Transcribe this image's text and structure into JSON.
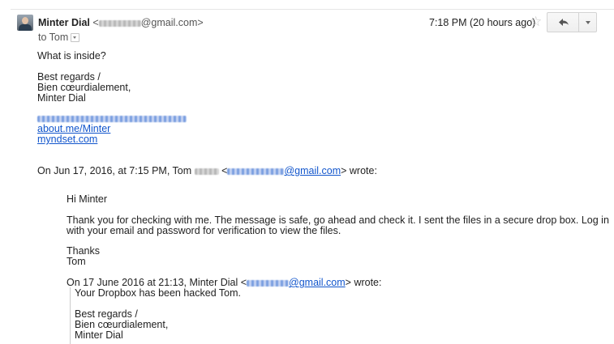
{
  "header": {
    "sender_name": "Minter Dial",
    "sender_email_pre": "<",
    "sender_email_domain": "@gmail.com>",
    "recipient_line": "to Tom",
    "date": "7:18 PM (20 hours ago)"
  },
  "body": {
    "line1": "What is inside?",
    "sig1": "Best regards /",
    "sig2": "Bien cœurdialement,",
    "sig3": "Minter Dial",
    "link1": "about.me/Minter",
    "link2": "myndset.com",
    "quote_head_pre": "On Jun 17, 2016, at 7:15 PM, Tom",
    "quote_head_mid": "<",
    "quote_head_domain": "@gmail.com",
    "quote_head_post": "> wrote:"
  },
  "quote": {
    "greeting": "Hi Minter",
    "p1_line1": "Thank you for checking with me. The message is safe, go ahead and check it. I sent the files in a secure drop box. Log in",
    "p1_line2": "with your email and password for verification to view the files.",
    "thanks": "Thanks",
    "name": "Tom",
    "nested_head_pre": "On 17 June 2016 at 21:13, Minter Dial <",
    "nested_head_domain": "@gmail.com",
    "nested_head_post": "> wrote:",
    "nested_line1": "Your Dropbox has been hacked Tom.",
    "nested_sig1": "Best regards /",
    "nested_sig2": "Bien cœurdialement,",
    "nested_sig3": "Minter Dial"
  },
  "icons": {
    "star": "star-icon",
    "reply": "reply-icon",
    "more": "chevron-down-icon"
  }
}
